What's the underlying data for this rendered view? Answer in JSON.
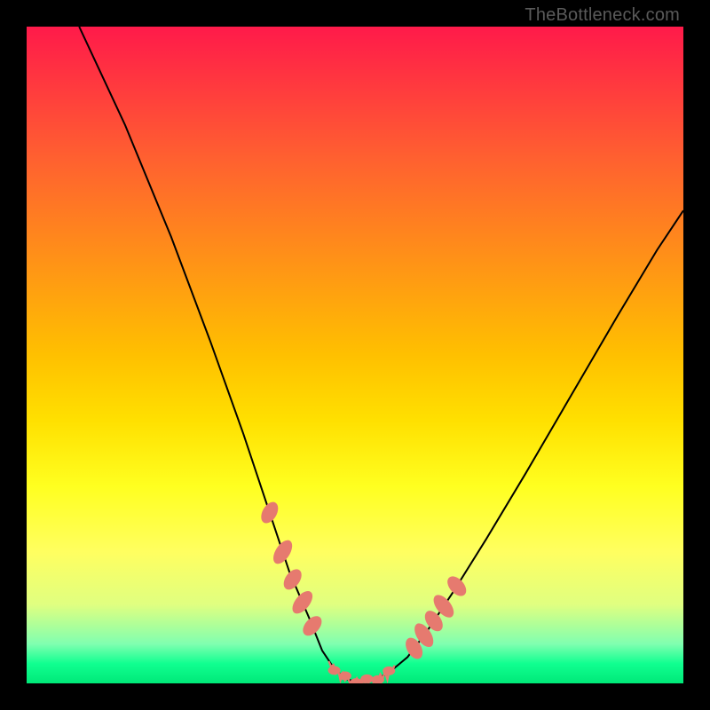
{
  "watermark": "TheBottleneck.com",
  "chart_data": {
    "type": "line",
    "title": "",
    "xlabel": "",
    "ylabel": "",
    "xlim": [
      0,
      100
    ],
    "ylim": [
      0,
      100
    ],
    "series": [
      {
        "name": "curve",
        "x": [
          8,
          15,
          22,
          28,
          33,
          37,
          40,
          43,
          45,
          47,
          49,
          51,
          53,
          55,
          58,
          61,
          65,
          70,
          76,
          83,
          90,
          96,
          100
        ],
        "values": [
          100,
          85,
          68,
          52,
          38,
          26,
          17,
          10,
          5,
          2,
          0.5,
          0.3,
          0.6,
          1.5,
          4,
          8,
          14,
          22,
          32,
          44,
          56,
          66,
          72
        ]
      }
    ],
    "markers": {
      "note": "salmon dotted clusters on descending and ascending flanks near the valley",
      "left_cluster_x": [
        37,
        39,
        40.5,
        42,
        43.5
      ],
      "right_cluster_x": [
        59,
        60.5,
        62,
        63.5,
        65.5
      ],
      "bottom_rough_x_range": [
        46,
        56
      ]
    },
    "background": {
      "type": "vertical-gradient",
      "stops": [
        "#ff1a4a",
        "#ffc000",
        "#ffff60",
        "#00e878"
      ]
    }
  }
}
